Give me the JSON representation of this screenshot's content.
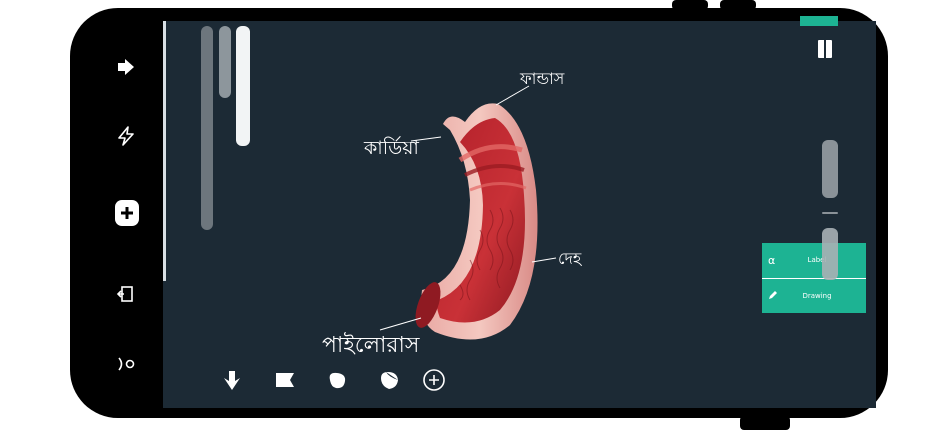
{
  "labels": {
    "fundus": "ফান্ডাস",
    "cardia": "কার্ডিয়া",
    "body": "দেহ",
    "pylorus": "পাইলোরাস"
  },
  "side_panel": {
    "label_button": "Label",
    "drawing_button": "Drawing",
    "label_icon": "α"
  },
  "left_nav_icons": [
    "arrow-right-icon",
    "lightning-icon",
    "plus-icon",
    "exit-icon",
    "rotate-icon"
  ],
  "tools": [
    "pointer-icon",
    "flag-icon",
    "blob-icon",
    "heart-icon",
    "add-circle-icon"
  ],
  "colors": {
    "screen_bg": "#1c2a35",
    "accent": "#1db393"
  }
}
